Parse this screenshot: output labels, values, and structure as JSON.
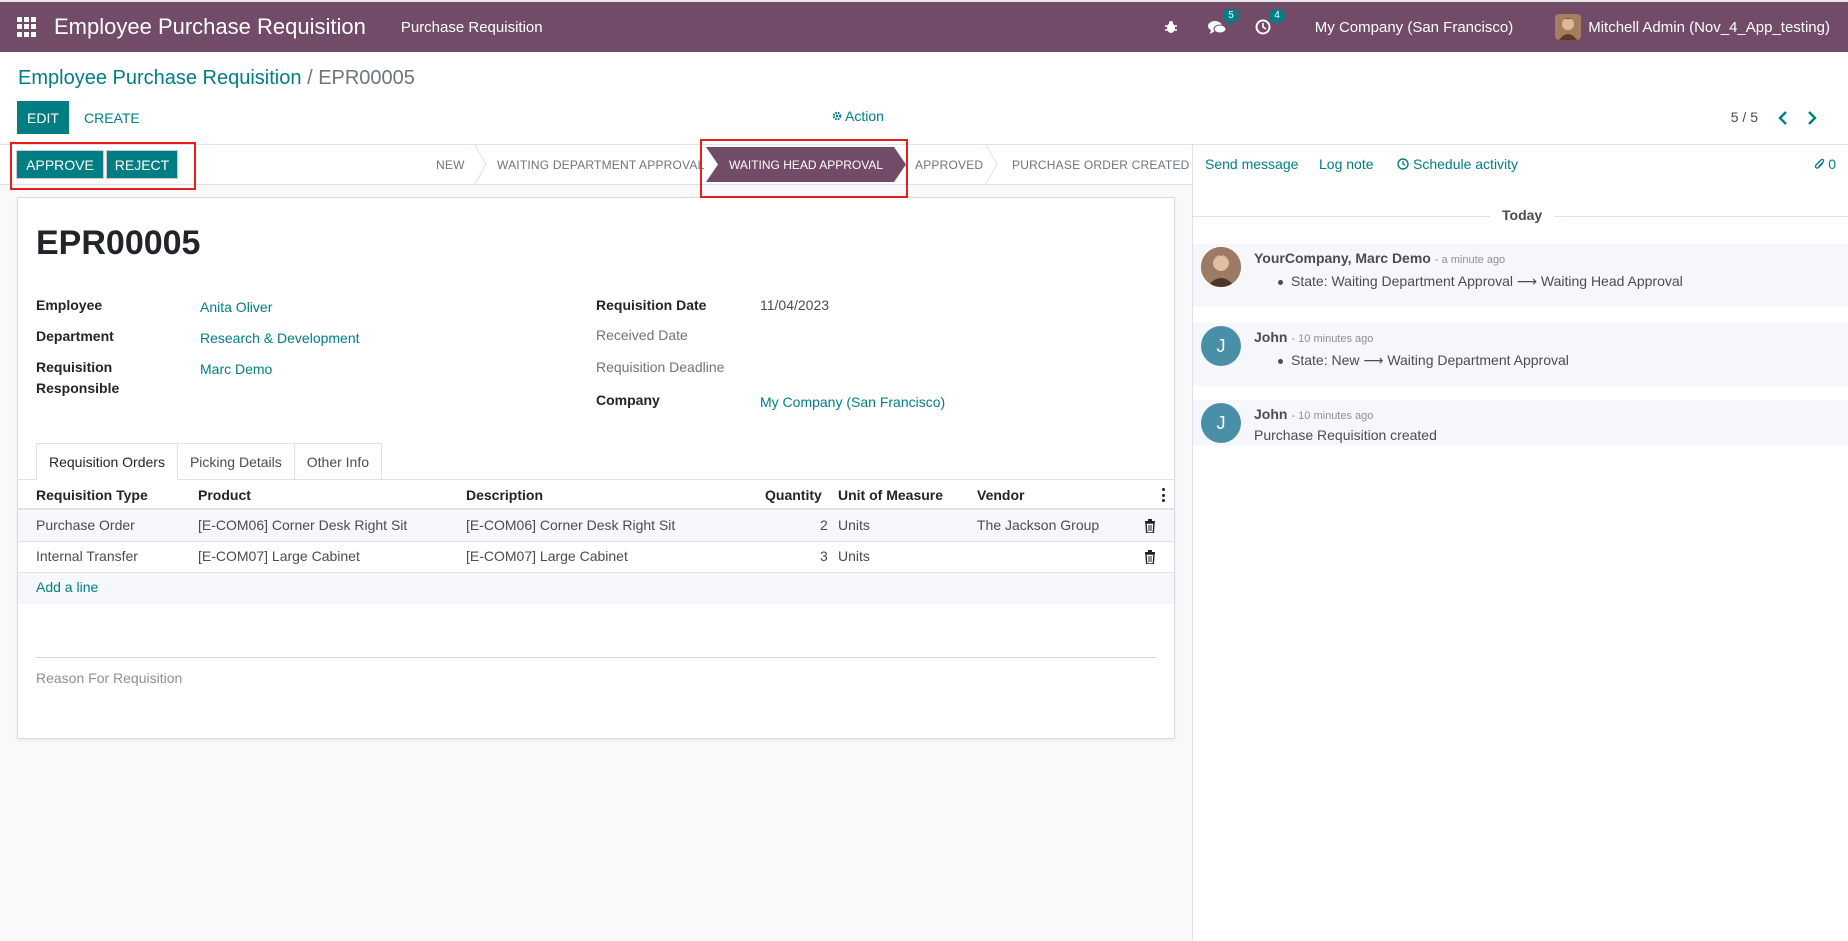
{
  "navbar": {
    "app_title": "Employee Purchase Requisition",
    "menu_item": "Purchase Requisition",
    "messages_count": "5",
    "activities_count": "4",
    "company": "My Company (San Francisco)",
    "user": "Mitchell Admin (Nov_4_App_testing)"
  },
  "breadcrumb": {
    "parent": "Employee Purchase Requisition",
    "separator": "/",
    "current": "EPR00005"
  },
  "toolbar": {
    "edit_label": "EDIT",
    "create_label": "CREATE",
    "action_label": "Action",
    "pager": "5 / 5"
  },
  "statusbar": {
    "approve_label": "APPROVE",
    "reject_label": "REJECT",
    "stages": [
      "NEW",
      "WAITING DEPARTMENT APPROVAL",
      "WAITING HEAD APPROVAL",
      "APPROVED",
      "PURCHASE ORDER CREATED"
    ],
    "current_stage": "WAITING HEAD APPROVAL"
  },
  "form": {
    "name": "EPR00005",
    "employee_label": "Employee",
    "employee_value": "Anita Oliver",
    "department_label": "Department",
    "department_value": "Research & Development",
    "responsible_label_1": "Requisition",
    "responsible_label_2": "Responsible",
    "responsible_value": "Marc Demo",
    "req_date_label": "Requisition Date",
    "req_date_value": "11/04/2023",
    "received_date_label": "Received Date",
    "deadline_label": "Requisition Deadline",
    "company_label": "Company",
    "company_value": "My Company (San Francisco)",
    "tabs": [
      "Requisition Orders",
      "Picking Details",
      "Other Info"
    ],
    "columns": [
      "Requisition Type",
      "Product",
      "Description",
      "Quantity",
      "Unit of Measure",
      "Vendor"
    ],
    "rows": [
      {
        "type": "Purchase Order",
        "product": "[E-COM06] Corner Desk Right Sit",
        "description": "[E-COM06] Corner Desk Right Sit",
        "quantity": "2",
        "uom": "Units",
        "vendor": "The Jackson Group"
      },
      {
        "type": "Internal Transfer",
        "product": "[E-COM07] Large Cabinet",
        "description": "[E-COM07] Large Cabinet",
        "quantity": "3",
        "uom": "Units",
        "vendor": ""
      }
    ],
    "add_line": "Add a line",
    "reason_label": "Reason For Requisition"
  },
  "chatter": {
    "send_message": "Send message",
    "log_note": "Log note",
    "schedule_activity": "Schedule activity",
    "attachments": "0",
    "date_separator": "Today",
    "messages": [
      {
        "author": "YourCompany, Marc Demo",
        "time": "- a minute ago",
        "body": "State: Waiting Department Approval ⟶ Waiting Head Approval"
      },
      {
        "author": "John",
        "avatar_letter": "J",
        "time": "- 10 minutes ago",
        "body": "State: New ⟶ Waiting Department Approval"
      },
      {
        "author": "John",
        "avatar_letter": "J",
        "time": "- 10 minutes ago",
        "body": "Purchase Requisition created"
      }
    ]
  },
  "colors": {
    "brand": "#714b67",
    "accent": "#017e84",
    "highlight": "#e61e1e",
    "avatar_j": "#4a8fa8"
  }
}
